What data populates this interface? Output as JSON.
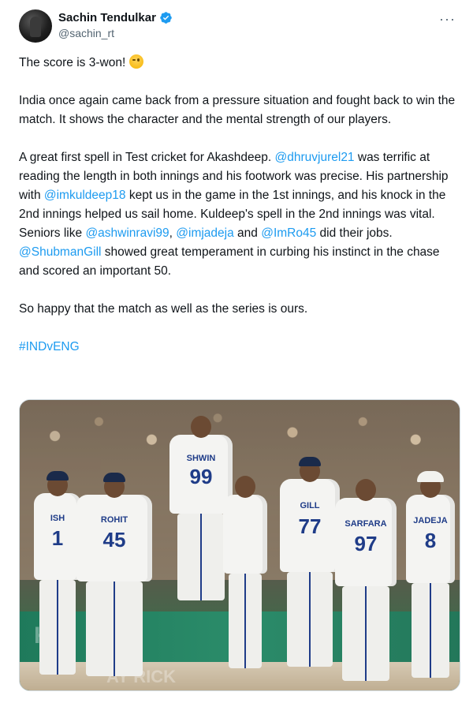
{
  "author": {
    "name": "Sachin Tendulkar",
    "handle": "@sachin_rt",
    "verified": true,
    "avatar_icon": "profile-avatar"
  },
  "menu": {
    "icon": "more-options-icon",
    "glyph": "···"
  },
  "tweet": {
    "p1_text": "The score is 3-won! ",
    "p1_emoji": "winking-face-emoji",
    "p2": "India once again came back from a pressure situation and fought back to win the match. It shows the character and the mental strength of our players.",
    "p3": {
      "t1": "A great first spell in Test cricket for Akashdeep. ",
      "m1": "@dhruvjurel21",
      "t2": " was terrific at reading the length in both innings and his footwork was precise. His partnership with ",
      "m2": "@imkuldeep18",
      "t3": " kept us in the game in the 1st innings, and his knock in the 2nd innings helped us sail home. Kuldeep's spell in the 2nd innings was vital. Seniors like ",
      "m3": "@ashwinravi99",
      "t4": ", ",
      "m4": "@imjadeja",
      "t5": " and ",
      "m5": "@ImRo45",
      "t6": " did their jobs. ",
      "m6": "@ShubmanGill",
      "t7": " showed great temperament in curbing his instinct in the chase and scored an important 50."
    },
    "p4": "So happy that the match as well as the series is ours.",
    "hashtag": "#INDvENG"
  },
  "photo": {
    "jersey_1": {
      "name": "ROHIT",
      "number": "45"
    },
    "jersey_2": {
      "name": "SHWIN",
      "number": "99"
    },
    "jersey_3": {
      "name": "SARFARA",
      "number": "97"
    },
    "jersey_4": {
      "name": "JADEJA",
      "number": "8"
    },
    "jersey_5": {
      "name": "ISH",
      "number": "1"
    },
    "jersey_6": {
      "name": "GILL",
      "number": "77"
    },
    "jersey_7": {
      "name": "",
      "number": ""
    },
    "board": "Kh",
    "board2": "AY  RICK"
  },
  "colors": {
    "link": "#1d9bf0",
    "text": "#0f1419",
    "muted": "#536471",
    "verified": "#1d9bf0"
  }
}
